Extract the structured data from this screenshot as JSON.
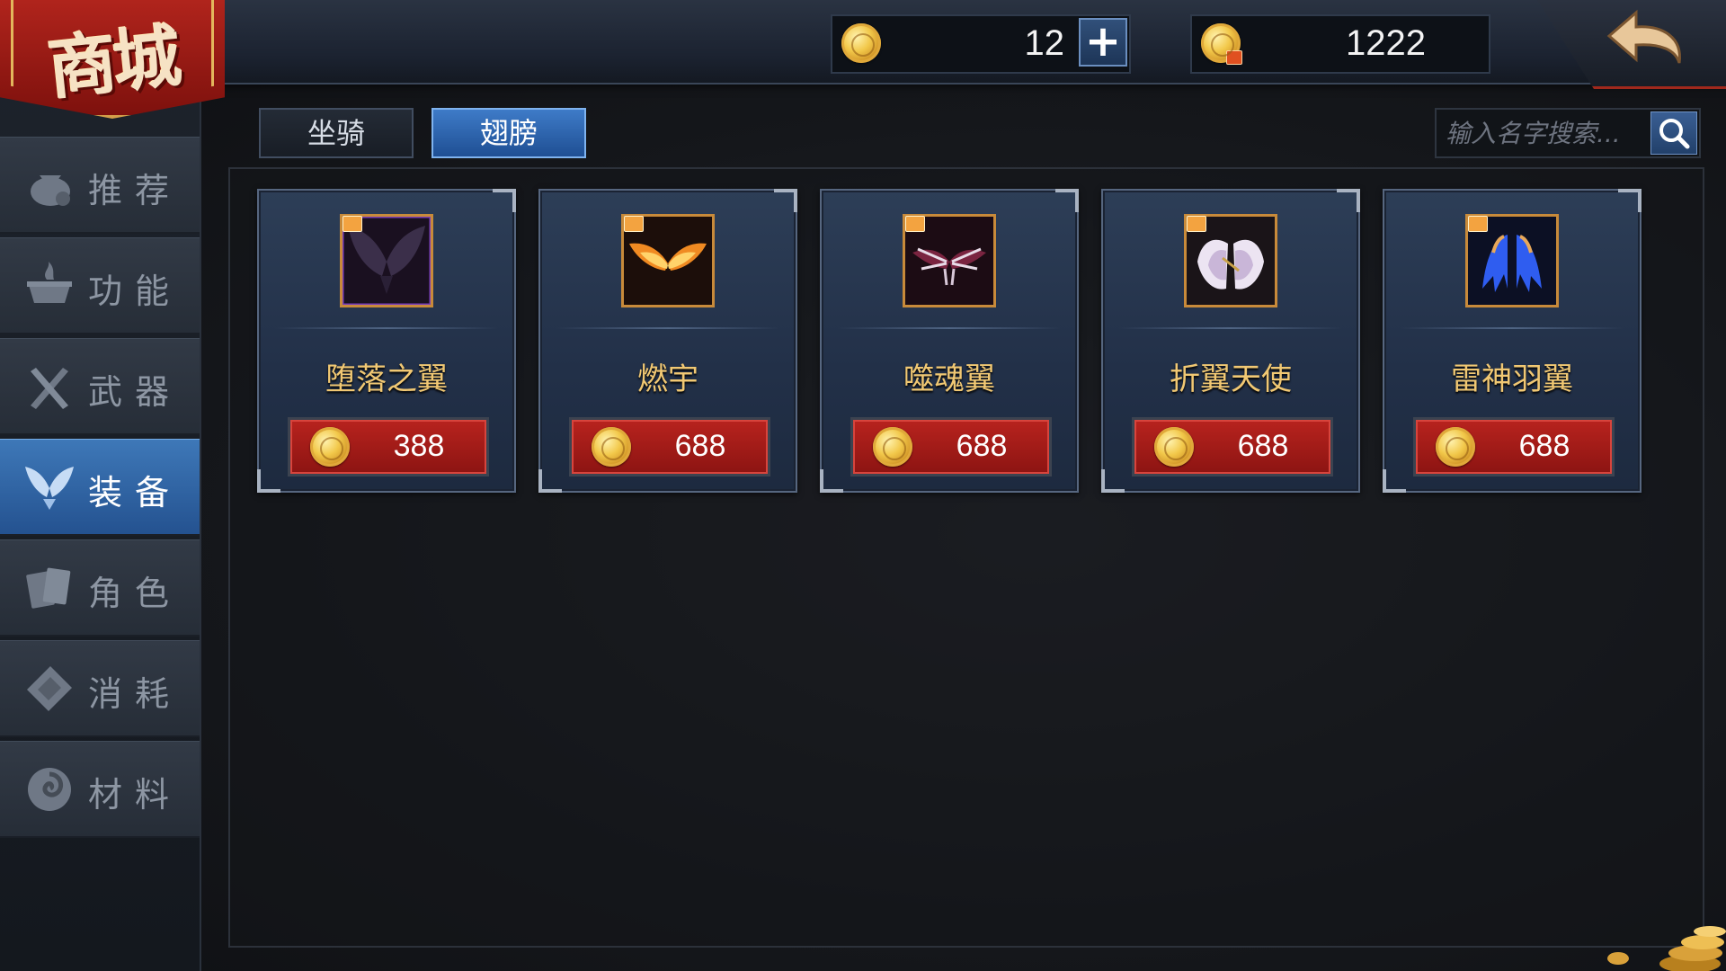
{
  "header": {
    "shop_title": "商城",
    "currency_gold": "12",
    "currency_bound_gold": "1222",
    "add_button": "+"
  },
  "sidebar": {
    "items": [
      {
        "label": "推荐",
        "icon": "recommend-bag-icon",
        "active": false
      },
      {
        "label": "功能",
        "icon": "function-cauldron-icon",
        "active": false
      },
      {
        "label": "武器",
        "icon": "weapon-swords-icon",
        "active": false
      },
      {
        "label": "装备",
        "icon": "equipment-wings-icon",
        "active": true
      },
      {
        "label": "角色",
        "icon": "character-cards-icon",
        "active": false
      },
      {
        "label": "消耗",
        "icon": "consumable-scroll-icon",
        "active": false
      },
      {
        "label": "材料",
        "icon": "material-swirl-icon",
        "active": false
      }
    ]
  },
  "tabs": [
    {
      "label": "坐骑",
      "active": false
    },
    {
      "label": "翅膀",
      "active": true
    }
  ],
  "search": {
    "placeholder": "输入名字搜索..."
  },
  "items": [
    {
      "name": "堕落之翼",
      "price": "388",
      "icon": "dark-wings-icon"
    },
    {
      "name": "燃宇",
      "price": "688",
      "icon": "flame-wings-icon"
    },
    {
      "name": "噬魂翼",
      "price": "688",
      "icon": "bone-wings-icon"
    },
    {
      "name": "折翼天使",
      "price": "688",
      "icon": "angel-wings-icon"
    },
    {
      "name": "雷神羽翼",
      "price": "688",
      "icon": "thunder-wings-icon"
    }
  ],
  "colors": {
    "accent_blue": "#2f64aa",
    "price_red": "#a81c18",
    "item_name_gold": "#f1c873",
    "logo_red": "#9c1b14"
  }
}
